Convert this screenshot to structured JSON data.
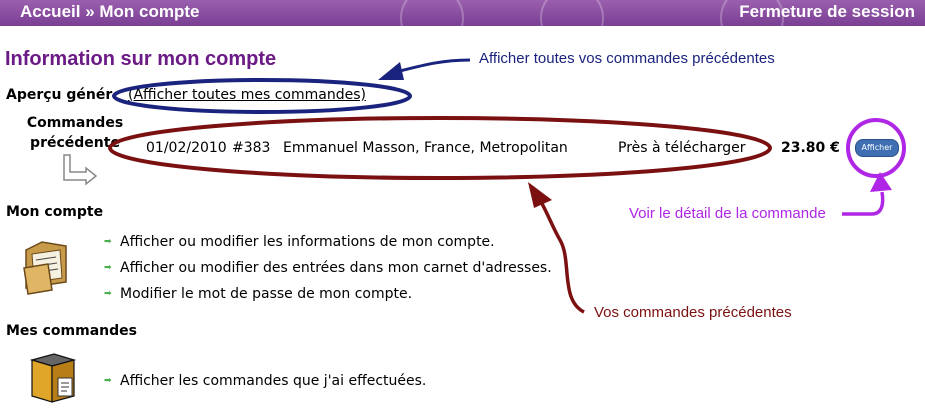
{
  "header": {
    "breadcrumb": "Accueil » Mon compte",
    "logoff": "Fermeture de session"
  },
  "page_title": "Information sur mon compte",
  "overview": {
    "heading": "Aperçu génér",
    "link": "(Afficher toutes mes commandes)",
    "previous_label_1": "Commandes",
    "previous_label_2": "précédente"
  },
  "order": {
    "date": "01/02/2010",
    "number": "#383",
    "customer": "Emmanuel Masson, France, Metropolitan",
    "status": "Près à télécharger",
    "total": "23.80 €",
    "button": "Afficher"
  },
  "account": {
    "heading": "Mon compte",
    "items": [
      "Afficher ou modifier les informations de mon compte.",
      "Afficher ou modifier des entrées dans mon carnet d'adresses.",
      "Modifier le mot de passe de mon compte."
    ]
  },
  "orders_section": {
    "heading": "Mes commandes",
    "items": [
      "Afficher les commandes que j'ai effectuées."
    ]
  },
  "annotations": {
    "show_all": "Afficher toutes vos commandes précédentes",
    "detail": "Voir le détail de la commande",
    "previous": "Vos commandes précédentes"
  },
  "colors": {
    "header": "#7a3f93",
    "title": "#6b1a86",
    "navy": "#1a237e",
    "maroon": "#7b1010",
    "violet": "#b026e6",
    "bullet": "#4caf50",
    "button": "#3f6fb2"
  }
}
